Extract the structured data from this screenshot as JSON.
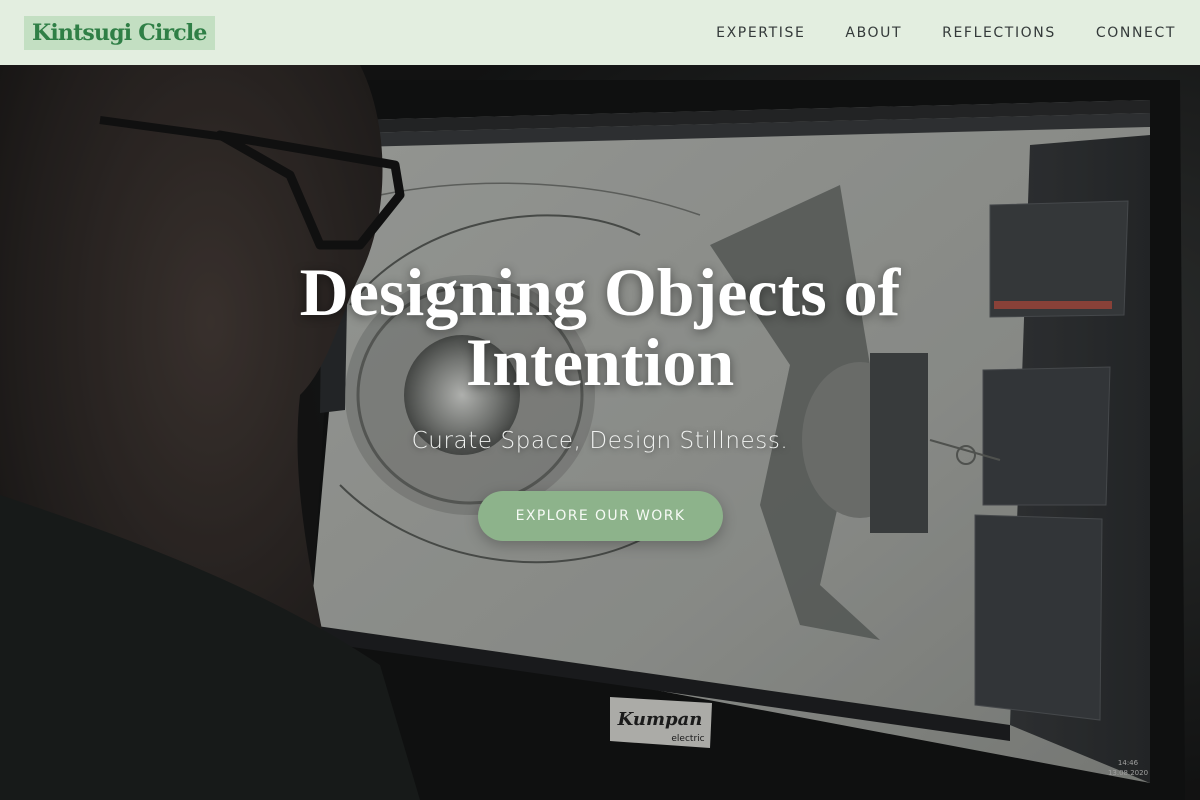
{
  "nav": {
    "logo": "Kintsugi Circle",
    "links": [
      "EXPERTISE",
      "ABOUT",
      "REFLECTIONS",
      "CONNECT"
    ]
  },
  "hero": {
    "title": "Designing Objects of Intention",
    "subtitle": "Curate Space, Design Stillness.",
    "cta_label": "EXPLORE OUR WORK",
    "monitor_brand": "Kumpan",
    "monitor_brand_sub": "electric",
    "clock_time": "14:46",
    "clock_date": "13.08.2020"
  },
  "colors": {
    "nav_bg": "#e3eee0",
    "logo_bg": "#c3dfc2",
    "logo_text": "#2f7f46",
    "cta_bg": "#8db38b"
  }
}
